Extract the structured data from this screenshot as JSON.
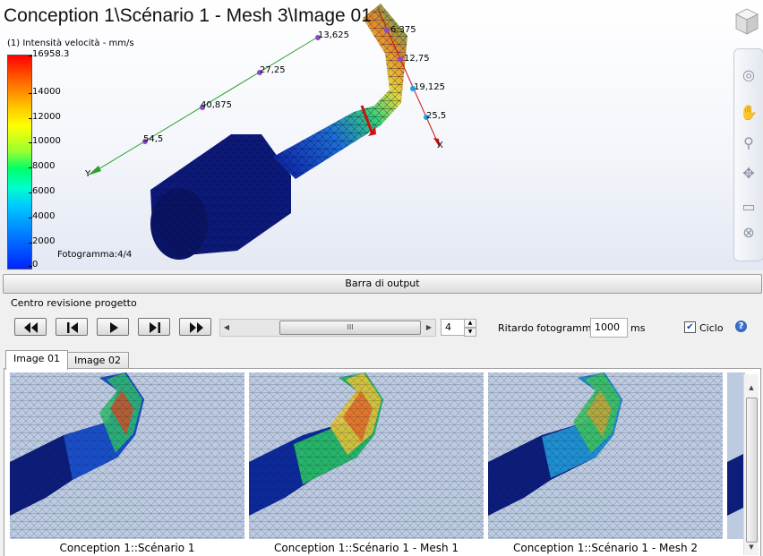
{
  "viewport": {
    "title": "Conception 1\\Scénario 1 - Mesh 3\\Image 01",
    "result_label": "(1) Intensità velocità - mm/s",
    "legend_ticks": [
      "16958.3",
      "14000",
      "12000",
      "10000",
      "8000",
      "6000",
      "4000",
      "2000",
      "0"
    ],
    "frame_label": "Fotogramma:4/4",
    "axis_labels": {
      "y_axis": [
        "54,5",
        "40,875",
        "27,25",
        "13,625"
      ],
      "x_axis": [
        "6,375",
        "12,75",
        "19,125",
        "25,5"
      ],
      "y_name": "Y",
      "x_name": "X"
    }
  },
  "output_bar_label": "Barra di output",
  "review": {
    "group_label": "Centro revisione progetto",
    "buttons": [
      "first-frame-icon",
      "previous-frame-icon",
      "play-icon",
      "next-frame-icon",
      "last-frame-icon"
    ],
    "slider_grip": "III",
    "frame_value": "4",
    "delay_label": "Ritardo fotogrammi:",
    "delay_value": "1000",
    "delay_unit": "ms",
    "loop_label": "Ciclo",
    "loop_checked": true
  },
  "tabs": [
    {
      "label": "Image 01",
      "active": true
    },
    {
      "label": "Image 02",
      "active": false
    }
  ],
  "thumbnails": [
    {
      "caption": "Conception 1::Scénario 1"
    },
    {
      "caption": "Conception 1::Scénario 1 - Mesh 1"
    },
    {
      "caption": "Conception 1::Scénario 1 - Mesh 2"
    }
  ]
}
